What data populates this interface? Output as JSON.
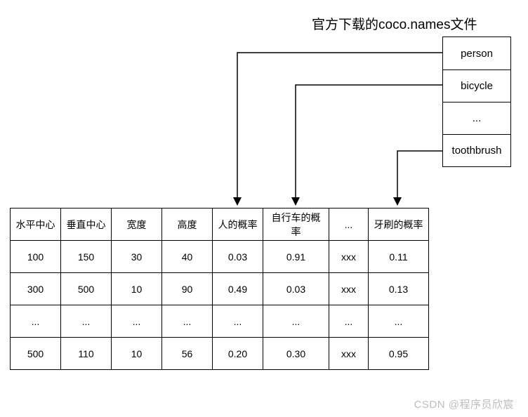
{
  "title": "官方下载的coco.names文件",
  "coco_list": [
    "person",
    "bicycle",
    "...",
    "toothbrush"
  ],
  "table": {
    "headers": [
      "水平中心",
      "垂直中心",
      "宽度",
      "高度",
      "人的概率",
      "自行车的概率",
      "...",
      "牙刷的概率"
    ],
    "rows": [
      [
        "100",
        "150",
        "30",
        "40",
        "0.03",
        "0.91",
        "xxx",
        "0.11"
      ],
      [
        "300",
        "500",
        "10",
        "90",
        "0.49",
        "0.03",
        "xxx",
        "0.13"
      ],
      [
        "...",
        "...",
        "...",
        "...",
        "...",
        "...",
        "...",
        "..."
      ],
      [
        "500",
        "110",
        "10",
        "56",
        "0.20",
        "0.30",
        "xxx",
        "0.95"
      ]
    ]
  },
  "watermark": "CSDN @程序员欣宸",
  "chart_data": {
    "type": "table",
    "title": "官方下载的coco.names文件",
    "coco_classes_sample": [
      "person",
      "bicycle",
      "...",
      "toothbrush"
    ],
    "columns": [
      "水平中心",
      "垂直中心",
      "宽度",
      "高度",
      "人的概率",
      "自行车的概率",
      "...",
      "牙刷的概率"
    ],
    "rows": [
      {
        "水平中心": 100,
        "垂直中心": 150,
        "宽度": 30,
        "高度": 40,
        "人的概率": 0.03,
        "自行车的概率": 0.91,
        "...": "xxx",
        "牙刷的概率": 0.11
      },
      {
        "水平中心": 300,
        "垂直中心": 500,
        "宽度": 10,
        "高度": 90,
        "人的概率": 0.49,
        "自行车的概率": 0.03,
        "...": "xxx",
        "牙刷的概率": 0.13
      },
      {
        "水平中心": "...",
        "垂直中心": "...",
        "宽度": "...",
        "高度": "...",
        "人的概率": "...",
        "自行车的概率": "...",
        "...": "...",
        "牙刷的概率": "..."
      },
      {
        "水平中心": 500,
        "垂直中心": 110,
        "宽度": 10,
        "高度": 56,
        "人的概率": 0.2,
        "自行车的概率": 0.3,
        "...": "xxx",
        "牙刷的概率": 0.95
      }
    ],
    "mapping_arrows": [
      {
        "from": "person",
        "to_column": "人的概率"
      },
      {
        "from": "bicycle",
        "to_column": "自行车的概率"
      },
      {
        "from": "toothbrush",
        "to_column": "牙刷的概率"
      }
    ]
  }
}
